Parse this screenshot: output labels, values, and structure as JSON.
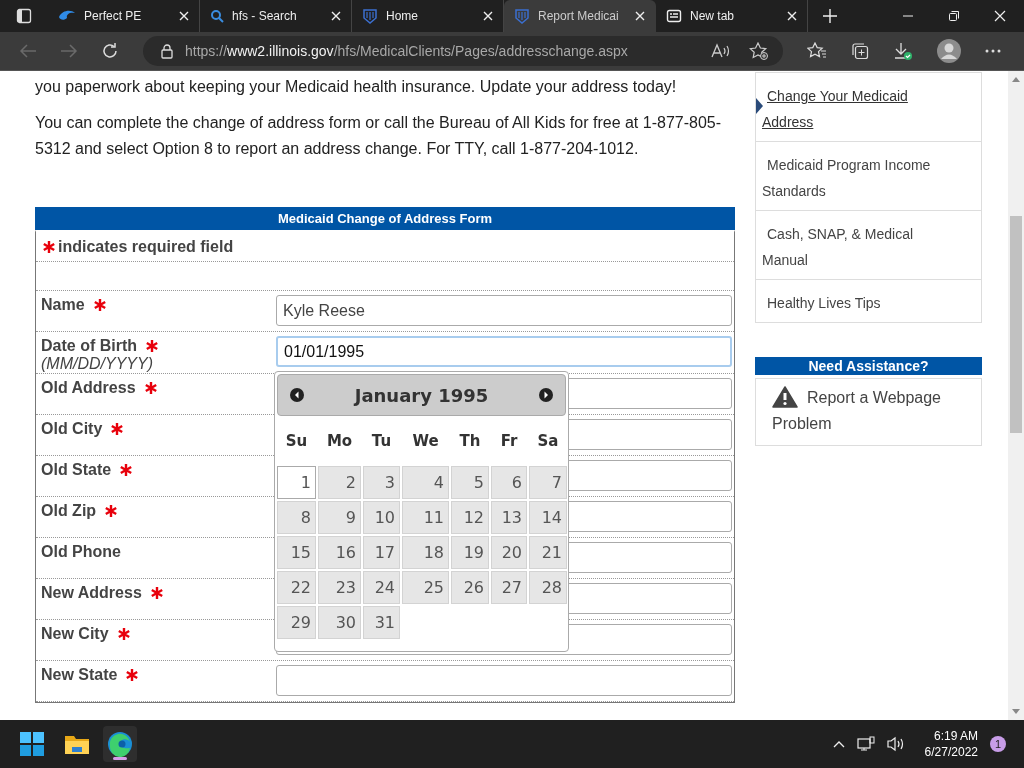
{
  "browser": {
    "tabs": [
      {
        "title": "Perfect PE",
        "kind": "swirl",
        "selected": false
      },
      {
        "title": "hfs - Search",
        "kind": "search",
        "selected": false
      },
      {
        "title": "Home",
        "kind": "crest",
        "selected": false
      },
      {
        "title": "Report Medicai",
        "kind": "crest",
        "selected": true
      },
      {
        "title": "New tab",
        "kind": "newtab",
        "selected": false
      }
    ],
    "url": {
      "scheme": "https://",
      "host": "www2.illinois.gov",
      "path": "/hfs/MedicalClients/Pages/addresschange.aspx"
    }
  },
  "page": {
    "paragraphs": [
      "you paperwork about keeping your Medicaid health insurance. Update your address today!",
      "You can complete the change of address form or call the Bureau of All Kids for free at 1-877-805-5312 and select Option 8 to report an address change. For TTY, call 1-877-204-1012."
    ],
    "form": {
      "title": "Medicaid Change of Address Form",
      "required_note": "indicates required field",
      "fields": [
        {
          "label": "Name",
          "required": true,
          "value": "Kyle Reese",
          "focused": false
        },
        {
          "label": "Date of Birth",
          "hint": "(MM/DD/YYYY)",
          "required": true,
          "value": "01/01/1995",
          "focused": true
        },
        {
          "label": "Old Address",
          "required": true,
          "focused": false
        },
        {
          "label": "Old City",
          "required": true,
          "focused": false
        },
        {
          "label": "Old State",
          "required": true,
          "focused": false
        },
        {
          "label": "Old Zip",
          "required": true,
          "focused": false
        },
        {
          "label": "Old Phone",
          "required": false,
          "focused": false
        },
        {
          "label": "New Address",
          "required": true,
          "focused": false
        },
        {
          "label": "New City",
          "required": true,
          "focused": false
        },
        {
          "label": "New State",
          "required": true,
          "focused": false
        }
      ]
    },
    "datepicker": {
      "title": "January 1995",
      "weekdays": [
        "Su",
        "Mo",
        "Tu",
        "We",
        "Th",
        "Fr",
        "Sa"
      ],
      "days": [
        {
          "day": "1",
          "selected": true
        },
        {
          "day": "2",
          "selected": false
        },
        {
          "day": "3",
          "selected": false
        },
        {
          "day": "4",
          "selected": false
        },
        {
          "day": "5",
          "selected": false
        },
        {
          "day": "6",
          "selected": false
        },
        {
          "day": "7",
          "selected": false
        },
        {
          "day": "8",
          "selected": false
        },
        {
          "day": "9",
          "selected": false
        },
        {
          "day": "10",
          "selected": false
        },
        {
          "day": "11",
          "selected": false
        },
        {
          "day": "12",
          "selected": false
        },
        {
          "day": "13",
          "selected": false
        },
        {
          "day": "14",
          "selected": false
        },
        {
          "day": "15",
          "selected": false
        },
        {
          "day": "16",
          "selected": false
        },
        {
          "day": "17",
          "selected": false
        },
        {
          "day": "18",
          "selected": false
        },
        {
          "day": "19",
          "selected": false
        },
        {
          "day": "20",
          "selected": false
        },
        {
          "day": "21",
          "selected": false
        },
        {
          "day": "22",
          "selected": false
        },
        {
          "day": "23",
          "selected": false
        },
        {
          "day": "24",
          "selected": false
        },
        {
          "day": "25",
          "selected": false
        },
        {
          "day": "26",
          "selected": false
        },
        {
          "day": "27",
          "selected": false
        },
        {
          "day": "28",
          "selected": false
        },
        {
          "day": "29",
          "selected": false
        },
        {
          "day": "30",
          "selected": false
        },
        {
          "day": "31",
          "selected": false
        }
      ]
    },
    "sidebar": {
      "links": [
        {
          "label": "Change Your Medicaid Address",
          "selected": true
        },
        {
          "label": "Medicaid Program Income Standards",
          "selected": false
        },
        {
          "label": "Cash, SNAP, & Medical Manual",
          "selected": false
        },
        {
          "label": "Healthy Lives Tips",
          "selected": false
        }
      ],
      "assistance": {
        "title": "Need Assistance?",
        "link": "Report a Webpage Problem"
      }
    }
  },
  "taskbar": {
    "time": "6:19 AM",
    "date": "6/27/2022",
    "notifications": "1"
  }
}
